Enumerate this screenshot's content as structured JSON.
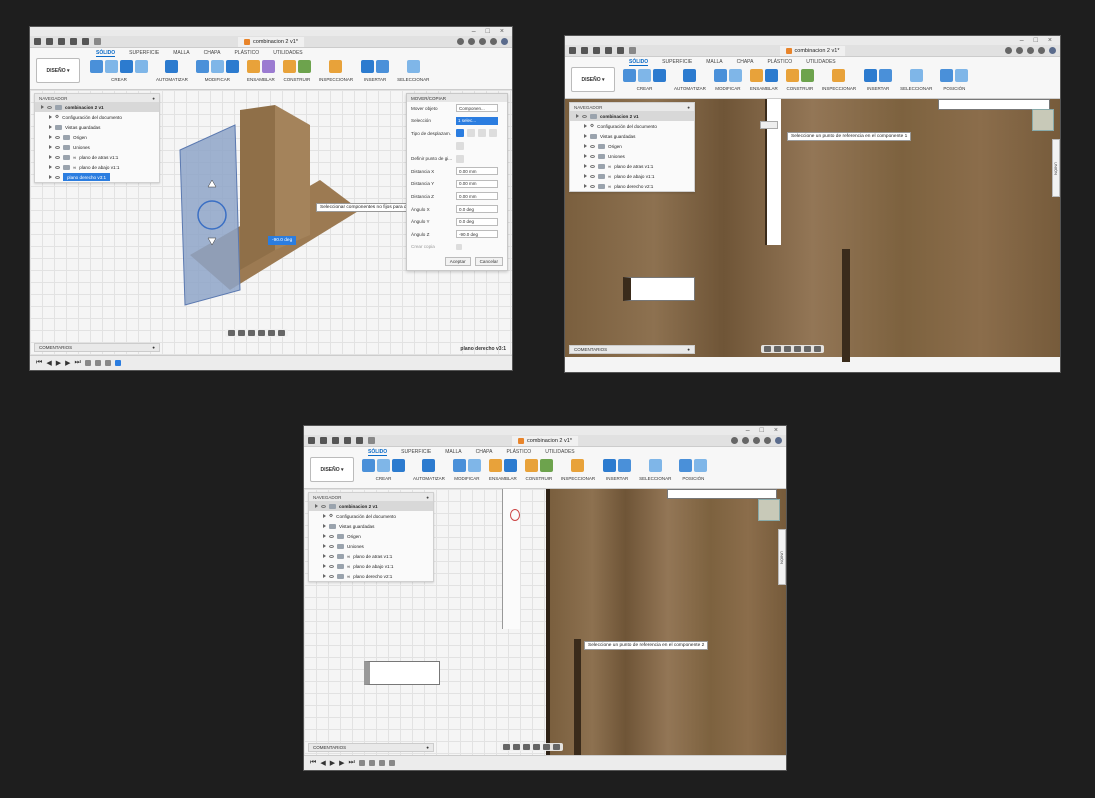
{
  "doc_title": "combinacion 2 v1*",
  "workspace_tabs": [
    "SÓLIDO",
    "SUPERFICIE",
    "MALLA",
    "CHAPA",
    "PLÁSTICO",
    "UTILIDADES"
  ],
  "diseno": "DISEÑO",
  "groups_a": [
    "CREAR",
    "AUTOMATIZAR",
    "MODIFICAR",
    "ENSAMBLAR",
    "CONSTRUIR",
    "INSPECCIONAR",
    "INSERTAR",
    "SELECCIONAR"
  ],
  "groups_b": [
    "CREAR",
    "AUTOMATIZAR",
    "MODIFICAR",
    "ENSAMBLAR",
    "CONSTRUIR",
    "INSPECCIONAR",
    "INSERTAR",
    "SELECCIONAR",
    "POSICIÓN"
  ],
  "navigator": {
    "title": "NAVEGADOR",
    "root": "combinacion 2 v1",
    "items": [
      "Configuración del documento",
      "Vistas guardadas",
      "Origen",
      "Uniones",
      "plano de atras v1:1",
      "plano de abajo v1:1"
    ],
    "last_a": "plano derecho v3:1",
    "last_b": "plano derecho v2:1"
  },
  "comments": "COMENTARIOS",
  "move_panel": {
    "title": "MOVER/COPIAR",
    "rows": [
      {
        "label": "Mover objeto",
        "value": "Componen..."
      },
      {
        "label": "Selección",
        "value": "1 selec..."
      },
      {
        "label": "Tipo de desplazam.",
        "value": ""
      },
      {
        "label": "",
        "value": ""
      },
      {
        "label": "Definir punto de gi...",
        "value": ""
      },
      {
        "label": "Distancia X",
        "value": "0.00 mm"
      },
      {
        "label": "Distancia Y",
        "value": "0.00 mm"
      },
      {
        "label": "Distancia Z",
        "value": "0.00 mm"
      },
      {
        "label": "Ángulo X",
        "value": "0.0 deg"
      },
      {
        "label": "Ángulo Y",
        "value": "0.0 deg"
      },
      {
        "label": "Ángulo Z",
        "value": "-90.0 deg"
      },
      {
        "label": "Crear copia",
        "value": ""
      }
    ],
    "ok": "Aceptar",
    "cancel": "Cancelar"
  },
  "tips": {
    "w1": "Seleccionar componentes no fijos para desplazarlos",
    "w1_input": "-90.0 deg",
    "w1_status": "plano derecho v3:1",
    "w2": "Seleccione un punto de referencia en el componente 1",
    "w3": "Seleccione un punto de referencia en el componente 2"
  },
  "side_label": "UNIÓN"
}
